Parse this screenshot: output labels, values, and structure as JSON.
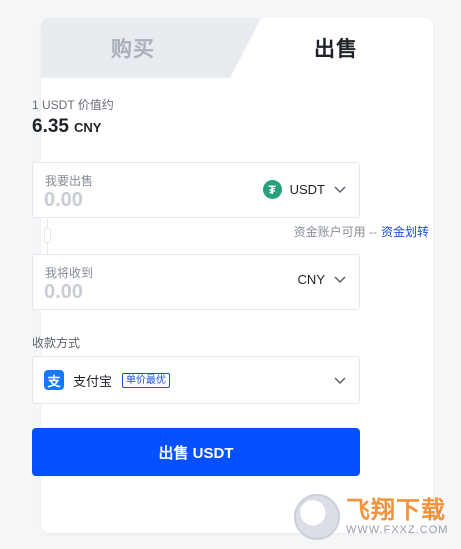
{
  "tabs": {
    "buy": "购买",
    "sell": "出售"
  },
  "price": {
    "label": "1 USDT 价值约",
    "value": "6.35",
    "unit": "CNY"
  },
  "sell_field": {
    "label": "我要出售",
    "placeholder": "0.00",
    "currency": "USDT",
    "currency_icon": "tether-icon"
  },
  "transfer": {
    "text": "资金账户可用 --",
    "link": "资金划转"
  },
  "receive_field": {
    "label": "我将收到",
    "placeholder": "0.00",
    "currency": "CNY"
  },
  "payment": {
    "label": "收款方式",
    "method": "支付宝",
    "badge": "单价最优",
    "method_icon": "alipay-icon",
    "alipay_glyph": "支"
  },
  "submit": {
    "label": "出售 USDT"
  },
  "watermark": {
    "title": "飞翔下载",
    "url": "WWW.FXXZ.COM"
  },
  "colors": {
    "accent": "#0550ff",
    "link": "#1a4fd6",
    "tether": "#26a17b",
    "alipay": "#1677ff"
  }
}
